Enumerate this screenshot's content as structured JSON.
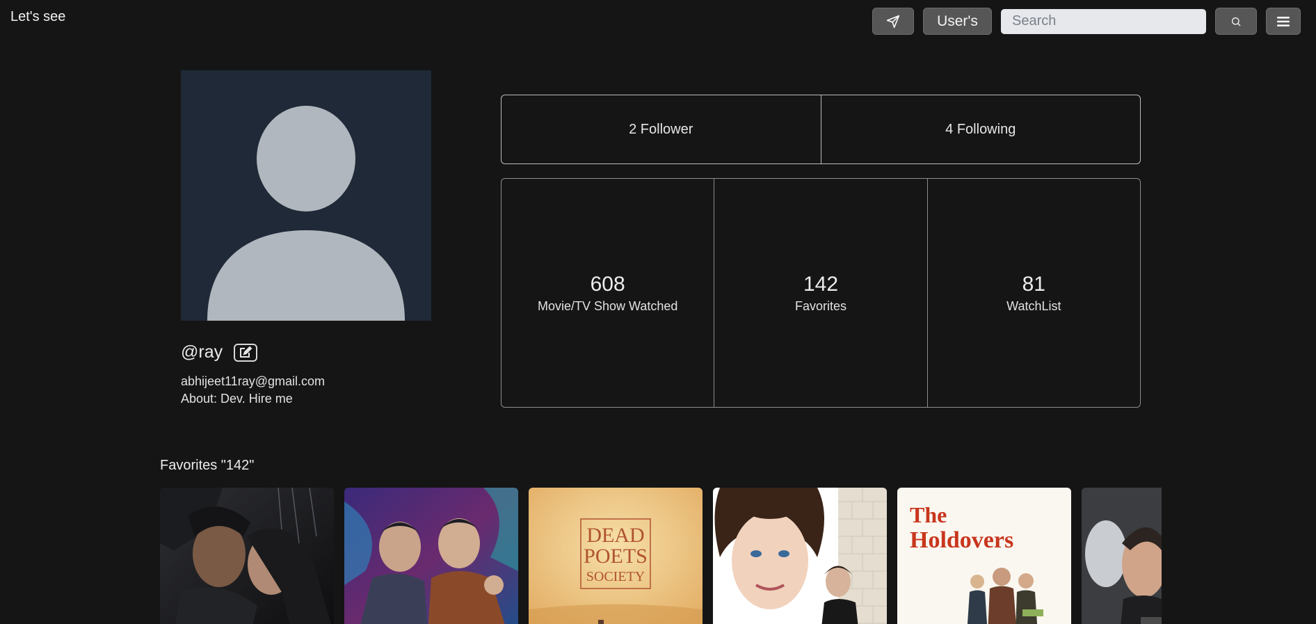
{
  "header": {
    "brand": "Let's see",
    "users_label": "User's",
    "search_placeholder": "Search"
  },
  "profile": {
    "username": "@ray",
    "email": "abhijeet11ray@gmail.com",
    "about": "About: Dev. Hire me"
  },
  "follow": {
    "followers": "2 Follower",
    "following": "4 Following"
  },
  "stats": [
    {
      "value": "608",
      "label": "Movie/TV Show Watched"
    },
    {
      "value": "142",
      "label": "Favorites"
    },
    {
      "value": "81",
      "label": "WatchList"
    }
  ],
  "favorites": {
    "heading": "Favorites \"142\"",
    "posters": [
      {
        "alt": "romance-drama-poster"
      },
      {
        "alt": "action-duo-poster"
      },
      {
        "alt": "dead-poets-society-poster",
        "text": [
          "DEAD",
          "POETS",
          "SOCIETY"
        ]
      },
      {
        "alt": "notting-hill-poster"
      },
      {
        "alt": "the-holdovers-poster",
        "text": [
          "The",
          "Holdovers"
        ]
      },
      {
        "alt": "partial-poster"
      }
    ]
  }
}
